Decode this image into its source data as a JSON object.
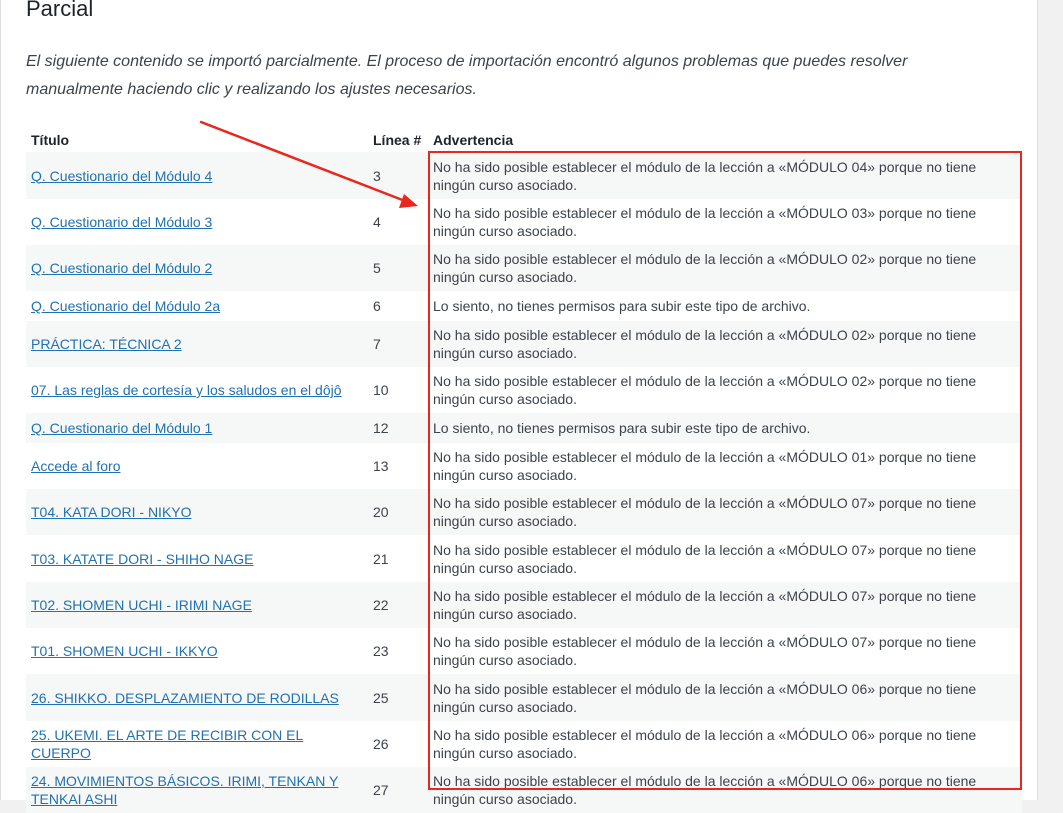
{
  "page": {
    "title": "Parcial",
    "description": "El siguiente contenido se importó parcialmente. El proceso de importación encontró algunos problemas que puedes resolver manualmente haciendo clic y realizando los ajustes necesarios."
  },
  "table": {
    "headers": {
      "title": "Título",
      "line": "Línea #",
      "warning": "Advertencia"
    },
    "rows": [
      {
        "title": "Q. Cuestionario del Módulo 4",
        "line": "3",
        "warning": "No ha sido posible establecer el módulo de la lección a «MÓDULO 04» porque no tiene ningún curso asociado."
      },
      {
        "title": "Q. Cuestionario del Módulo 3",
        "line": "4",
        "warning": "No ha sido posible establecer el módulo de la lección a «MÓDULO 03» porque no tiene ningún curso asociado."
      },
      {
        "title": "Q. Cuestionario del Módulo 2",
        "line": "5",
        "warning": "No ha sido posible establecer el módulo de la lección a «MÓDULO 02» porque no tiene ningún curso asociado."
      },
      {
        "title": "Q. Cuestionario del Módulo 2a",
        "line": "6",
        "warning": "Lo siento, no tienes permisos para subir este tipo de archivo."
      },
      {
        "title": "PRÁCTICA: TÉCNICA 2",
        "line": "7",
        "warning": "No ha sido posible establecer el módulo de la lección a «MÓDULO 02» porque no tiene ningún curso asociado."
      },
      {
        "title": "07. Las reglas de cortesía y los saludos en el dôjô",
        "line": "10",
        "warning": "No ha sido posible establecer el módulo de la lección a «MÓDULO 02» porque no tiene ningún curso asociado."
      },
      {
        "title": "Q. Cuestionario del Módulo 1",
        "line": "12",
        "warning": "Lo siento, no tienes permisos para subir este tipo de archivo."
      },
      {
        "title": "Accede al foro",
        "line": "13",
        "warning": "No ha sido posible establecer el módulo de la lección a «MÓDULO 01» porque no tiene ningún curso asociado."
      },
      {
        "title": "T04. KATA DORI - NIKYO",
        "line": "20",
        "warning": "No ha sido posible establecer el módulo de la lección a «MÓDULO 07» porque no tiene ningún curso asociado."
      },
      {
        "title": "T03. KATATE DORI - SHIHO NAGE",
        "line": "21",
        "warning": "No ha sido posible establecer el módulo de la lección a «MÓDULO 07» porque no tiene ningún curso asociado."
      },
      {
        "title": "T02. SHOMEN UCHI - IRIMI NAGE",
        "line": "22",
        "warning": "No ha sido posible establecer el módulo de la lección a «MÓDULO 07» porque no tiene ningún curso asociado."
      },
      {
        "title": "T01. SHOMEN UCHI - IKKYO",
        "line": "23",
        "warning": "No ha sido posible establecer el módulo de la lección a «MÓDULO 07» porque no tiene ningún curso asociado."
      },
      {
        "title": "26. SHIKKO. DESPLAZAMIENTO DE RODILLAS",
        "line": "25",
        "warning": "No ha sido posible establecer el módulo de la lección a «MÓDULO 06» porque no tiene ningún curso asociado."
      },
      {
        "title": "25. UKEMI. EL ARTE DE RECIBIR CON EL CUERPO",
        "line": "26",
        "warning": "No ha sido posible establecer el módulo de la lección a «MÓDULO 06» porque no tiene ningún curso asociado."
      },
      {
        "title": "24. MOVIMIENTOS BÁSICOS. IRIMI, TENKAN Y TENKAI ASHI",
        "line": "27",
        "warning": "No ha sido posible establecer el módulo de la lección a «MÓDULO 06» porque no tiene ningún curso asociado."
      }
    ]
  },
  "annotation": {
    "color": "#e8281c"
  }
}
